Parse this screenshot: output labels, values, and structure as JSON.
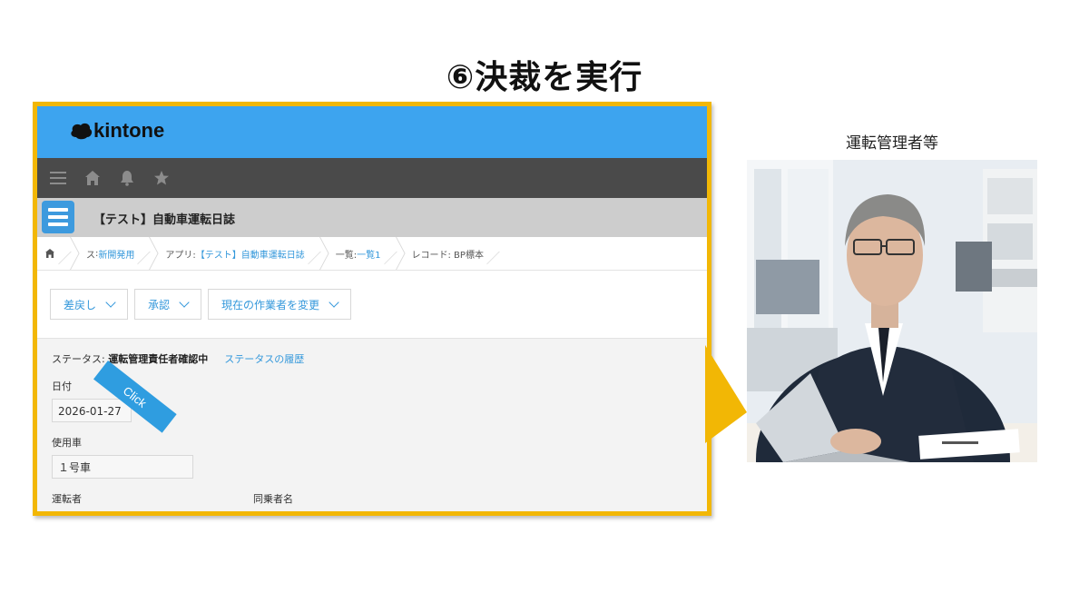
{
  "slide": {
    "title": "⑥決裁を実行"
  },
  "kintone": {
    "logo_text": "kintone",
    "nav_icons": [
      "menu-icon",
      "home-icon",
      "bell-icon",
      "star-icon"
    ],
    "app_title": "【テスト】自動車運転日誌",
    "breadcrumb": {
      "space_prefix": "ス",
      "space_suffix": ": ",
      "space_link": "新開発用",
      "app_prefix": "アプリ: ",
      "app_link": "【テスト】自動車運転日誌",
      "view_prefix": "一覧: ",
      "view_link": "一覧1",
      "record": "レコード: BP標本"
    },
    "actions": {
      "return": "差戻し",
      "approve": "承認",
      "change_assignee": "現在の作業者を変更"
    },
    "status": {
      "label": "ステータス: ",
      "value": "運転管理責任者確認中",
      "history_link": "ステータスの履歴"
    },
    "fields": {
      "date_label": "日付",
      "date_value": "2026-01-27",
      "car_label": "使用車",
      "car_value": "１号車",
      "driver_label": "運転者",
      "passenger_label": "同乗者名"
    }
  },
  "annotation": {
    "click_label": "Click"
  },
  "side": {
    "label": "運転管理者等"
  },
  "colors": {
    "frame": "#f2b705",
    "header_blue": "#3da4ef",
    "nav_dark": "#4a4a4a",
    "link_blue": "#3498db"
  }
}
